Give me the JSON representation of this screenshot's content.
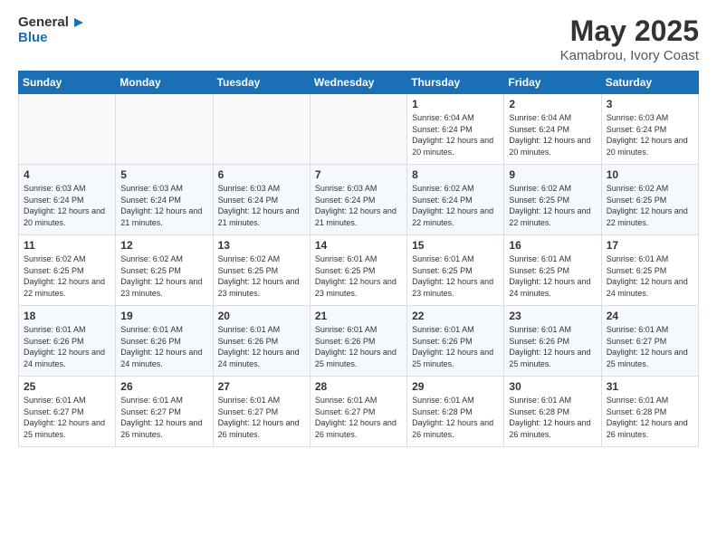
{
  "header": {
    "logo_general": "General",
    "logo_blue": "Blue",
    "title": "May 2025",
    "location": "Kamabrou, Ivory Coast"
  },
  "weekdays": [
    "Sunday",
    "Monday",
    "Tuesday",
    "Wednesday",
    "Thursday",
    "Friday",
    "Saturday"
  ],
  "weeks": [
    [
      {
        "day": "",
        "info": ""
      },
      {
        "day": "",
        "info": ""
      },
      {
        "day": "",
        "info": ""
      },
      {
        "day": "",
        "info": ""
      },
      {
        "day": "1",
        "info": "Sunrise: 6:04 AM\nSunset: 6:24 PM\nDaylight: 12 hours\nand 20 minutes."
      },
      {
        "day": "2",
        "info": "Sunrise: 6:04 AM\nSunset: 6:24 PM\nDaylight: 12 hours\nand 20 minutes."
      },
      {
        "day": "3",
        "info": "Sunrise: 6:03 AM\nSunset: 6:24 PM\nDaylight: 12 hours\nand 20 minutes."
      }
    ],
    [
      {
        "day": "4",
        "info": "Sunrise: 6:03 AM\nSunset: 6:24 PM\nDaylight: 12 hours\nand 20 minutes."
      },
      {
        "day": "5",
        "info": "Sunrise: 6:03 AM\nSunset: 6:24 PM\nDaylight: 12 hours\nand 21 minutes."
      },
      {
        "day": "6",
        "info": "Sunrise: 6:03 AM\nSunset: 6:24 PM\nDaylight: 12 hours\nand 21 minutes."
      },
      {
        "day": "7",
        "info": "Sunrise: 6:03 AM\nSunset: 6:24 PM\nDaylight: 12 hours\nand 21 minutes."
      },
      {
        "day": "8",
        "info": "Sunrise: 6:02 AM\nSunset: 6:24 PM\nDaylight: 12 hours\nand 22 minutes."
      },
      {
        "day": "9",
        "info": "Sunrise: 6:02 AM\nSunset: 6:25 PM\nDaylight: 12 hours\nand 22 minutes."
      },
      {
        "day": "10",
        "info": "Sunrise: 6:02 AM\nSunset: 6:25 PM\nDaylight: 12 hours\nand 22 minutes."
      }
    ],
    [
      {
        "day": "11",
        "info": "Sunrise: 6:02 AM\nSunset: 6:25 PM\nDaylight: 12 hours\nand 22 minutes."
      },
      {
        "day": "12",
        "info": "Sunrise: 6:02 AM\nSunset: 6:25 PM\nDaylight: 12 hours\nand 23 minutes."
      },
      {
        "day": "13",
        "info": "Sunrise: 6:02 AM\nSunset: 6:25 PM\nDaylight: 12 hours\nand 23 minutes."
      },
      {
        "day": "14",
        "info": "Sunrise: 6:01 AM\nSunset: 6:25 PM\nDaylight: 12 hours\nand 23 minutes."
      },
      {
        "day": "15",
        "info": "Sunrise: 6:01 AM\nSunset: 6:25 PM\nDaylight: 12 hours\nand 23 minutes."
      },
      {
        "day": "16",
        "info": "Sunrise: 6:01 AM\nSunset: 6:25 PM\nDaylight: 12 hours\nand 24 minutes."
      },
      {
        "day": "17",
        "info": "Sunrise: 6:01 AM\nSunset: 6:25 PM\nDaylight: 12 hours\nand 24 minutes."
      }
    ],
    [
      {
        "day": "18",
        "info": "Sunrise: 6:01 AM\nSunset: 6:26 PM\nDaylight: 12 hours\nand 24 minutes."
      },
      {
        "day": "19",
        "info": "Sunrise: 6:01 AM\nSunset: 6:26 PM\nDaylight: 12 hours\nand 24 minutes."
      },
      {
        "day": "20",
        "info": "Sunrise: 6:01 AM\nSunset: 6:26 PM\nDaylight: 12 hours\nand 24 minutes."
      },
      {
        "day": "21",
        "info": "Sunrise: 6:01 AM\nSunset: 6:26 PM\nDaylight: 12 hours\nand 25 minutes."
      },
      {
        "day": "22",
        "info": "Sunrise: 6:01 AM\nSunset: 6:26 PM\nDaylight: 12 hours\nand 25 minutes."
      },
      {
        "day": "23",
        "info": "Sunrise: 6:01 AM\nSunset: 6:26 PM\nDaylight: 12 hours\nand 25 minutes."
      },
      {
        "day": "24",
        "info": "Sunrise: 6:01 AM\nSunset: 6:27 PM\nDaylight: 12 hours\nand 25 minutes."
      }
    ],
    [
      {
        "day": "25",
        "info": "Sunrise: 6:01 AM\nSunset: 6:27 PM\nDaylight: 12 hours\nand 25 minutes."
      },
      {
        "day": "26",
        "info": "Sunrise: 6:01 AM\nSunset: 6:27 PM\nDaylight: 12 hours\nand 26 minutes."
      },
      {
        "day": "27",
        "info": "Sunrise: 6:01 AM\nSunset: 6:27 PM\nDaylight: 12 hours\nand 26 minutes."
      },
      {
        "day": "28",
        "info": "Sunrise: 6:01 AM\nSunset: 6:27 PM\nDaylight: 12 hours\nand 26 minutes."
      },
      {
        "day": "29",
        "info": "Sunrise: 6:01 AM\nSunset: 6:28 PM\nDaylight: 12 hours\nand 26 minutes."
      },
      {
        "day": "30",
        "info": "Sunrise: 6:01 AM\nSunset: 6:28 PM\nDaylight: 12 hours\nand 26 minutes."
      },
      {
        "day": "31",
        "info": "Sunrise: 6:01 AM\nSunset: 6:28 PM\nDaylight: 12 hours\nand 26 minutes."
      }
    ]
  ]
}
